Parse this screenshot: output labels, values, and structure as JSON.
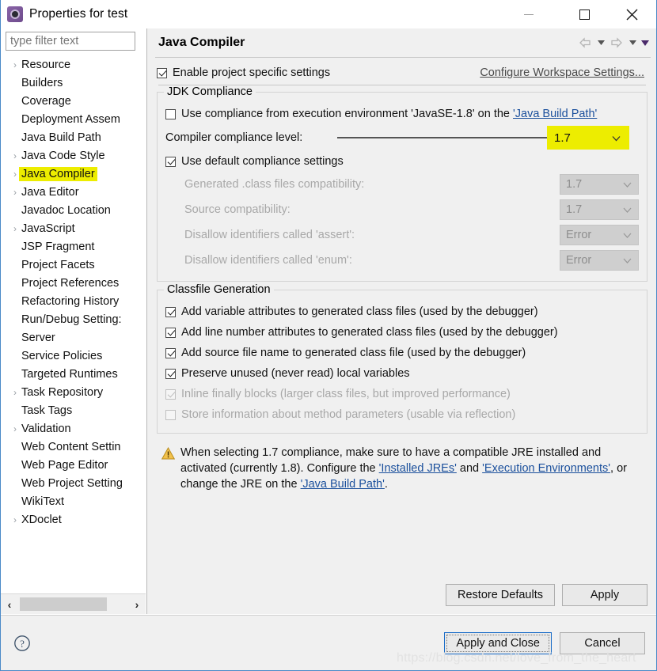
{
  "window": {
    "title": "Properties for test",
    "icon": "eclipse-gear-icon",
    "minimize_label": "Minimize",
    "maximize_label": "Maximize",
    "close_label": "Close"
  },
  "sidebar": {
    "filter_placeholder": "type filter text",
    "filter_value": "",
    "items": [
      {
        "label": "Resource",
        "expandable": true,
        "selected": false
      },
      {
        "label": "Builders",
        "expandable": false,
        "selected": false
      },
      {
        "label": "Coverage",
        "expandable": false,
        "selected": false
      },
      {
        "label": "Deployment Assem",
        "expandable": false,
        "selected": false
      },
      {
        "label": "Java Build Path",
        "expandable": false,
        "selected": false
      },
      {
        "label": "Java Code Style",
        "expandable": true,
        "selected": false
      },
      {
        "label": "Java Compiler",
        "expandable": true,
        "selected": true
      },
      {
        "label": "Java Editor",
        "expandable": true,
        "selected": false
      },
      {
        "label": "Javadoc Location",
        "expandable": false,
        "selected": false
      },
      {
        "label": "JavaScript",
        "expandable": true,
        "selected": false
      },
      {
        "label": "JSP Fragment",
        "expandable": false,
        "selected": false
      },
      {
        "label": "Project Facets",
        "expandable": false,
        "selected": false
      },
      {
        "label": "Project References",
        "expandable": false,
        "selected": false
      },
      {
        "label": "Refactoring History",
        "expandable": false,
        "selected": false
      },
      {
        "label": "Run/Debug Setting:",
        "expandable": false,
        "selected": false
      },
      {
        "label": "Server",
        "expandable": false,
        "selected": false
      },
      {
        "label": "Service Policies",
        "expandable": false,
        "selected": false
      },
      {
        "label": "Targeted Runtimes",
        "expandable": false,
        "selected": false
      },
      {
        "label": "Task Repository",
        "expandable": true,
        "selected": false
      },
      {
        "label": "Task Tags",
        "expandable": false,
        "selected": false
      },
      {
        "label": "Validation",
        "expandable": true,
        "selected": false
      },
      {
        "label": "Web Content Settin",
        "expandable": false,
        "selected": false
      },
      {
        "label": "Web Page Editor",
        "expandable": false,
        "selected": false
      },
      {
        "label": "Web Project Setting",
        "expandable": false,
        "selected": false
      },
      {
        "label": "WikiText",
        "expandable": false,
        "selected": false
      },
      {
        "label": "XDoclet",
        "expandable": true,
        "selected": false
      }
    ],
    "scroll_left_label": "‹",
    "scroll_right_label": "›"
  },
  "page": {
    "title": "Java Compiler",
    "enable_project_specific": {
      "label": "Enable project specific settings",
      "checked": true
    },
    "configure_workspace_link": "Configure Workspace Settings..."
  },
  "jdk_compliance": {
    "group_title": "JDK Compliance",
    "use_execution_env": {
      "prefix": "Use compliance from execution environment 'JavaSE-1.8' on the ",
      "link": "'Java Build Path'",
      "checked": false
    },
    "compliance_level": {
      "label": "Compiler compliance level:",
      "value": "1.7",
      "highlighted": true
    },
    "use_default_compliance": {
      "label": "Use default compliance settings",
      "checked": true
    },
    "fields": [
      {
        "label": "Generated .class files compatibility:",
        "value": "1.7",
        "disabled": true
      },
      {
        "label": "Source compatibility:",
        "value": "1.7",
        "disabled": true
      },
      {
        "label": "Disallow identifiers called 'assert':",
        "value": "Error",
        "disabled": true
      },
      {
        "label": "Disallow identifiers called 'enum':",
        "value": "Error",
        "disabled": true
      }
    ]
  },
  "classfile_generation": {
    "group_title": "Classfile Generation",
    "options": [
      {
        "label": "Add variable attributes to generated class files (used by the debugger)",
        "checked": true,
        "disabled": false
      },
      {
        "label": "Add line number attributes to generated class files (used by the debugger)",
        "checked": true,
        "disabled": false
      },
      {
        "label": "Add source file name to generated class file (used by the debugger)",
        "checked": true,
        "disabled": false
      },
      {
        "label": "Preserve unused (never read) local variables",
        "checked": true,
        "disabled": false
      },
      {
        "label": "Inline finally blocks (larger class files, but improved performance)",
        "checked": true,
        "disabled": true
      },
      {
        "label": "Store information about method parameters (usable via reflection)",
        "checked": false,
        "disabled": true
      }
    ]
  },
  "warning": {
    "icon": "warning-triangle-icon",
    "part1": "When selecting 1.7 compliance, make sure to have a compatible JRE installed and activated (currently 1.8). Configure the ",
    "link1": "'Installed JREs'",
    "part2": " and ",
    "link2": "'Execution Environments'",
    "part3": ", or change the JRE on the ",
    "link3": "'Java Build Path'",
    "part4": "."
  },
  "buttons": {
    "restore_defaults": "Restore Defaults",
    "apply": "Apply",
    "apply_and_close": "Apply and Close",
    "cancel": "Cancel"
  },
  "footer": {
    "help_icon": "help-question-icon",
    "watermark": "https://blog.csdn.net/love_from_the_heart"
  },
  "colors": {
    "highlight_yellow": "#eded00",
    "link_blue": "#1a4f9c",
    "default_button_border": "#1569c6",
    "window_border": "#4a89c8"
  }
}
